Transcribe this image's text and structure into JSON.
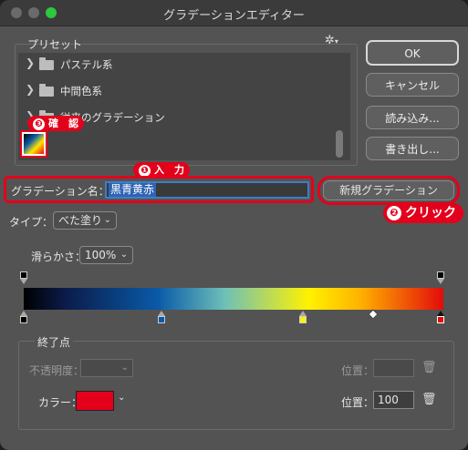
{
  "window": {
    "title": "グラデーションエディター"
  },
  "presets": {
    "label": "プリセット",
    "items": [
      {
        "label": "パステル系"
      },
      {
        "label": "中間色系"
      },
      {
        "label": "従来のグラデーション"
      }
    ]
  },
  "buttons": {
    "ok": "OK",
    "cancel": "キャンセル",
    "load": "読み込み...",
    "save": "書き出し...",
    "new_gradient": "新規グラデーション"
  },
  "annotations": {
    "input_num": "❶",
    "input_text": "入　力",
    "click_num": "❷",
    "click_text": "クリック",
    "confirm_num": "❸",
    "confirm_text": "確　認"
  },
  "name": {
    "label": "グラデーション名：",
    "value": "黒青黄赤"
  },
  "type": {
    "label": "タイプ：",
    "value": "べた塗り"
  },
  "smoothness": {
    "label": "滑らかさ：",
    "value": "100%"
  },
  "gradient": {
    "colors": [
      "#000000",
      "#0a5aa8",
      "#fff200",
      "#e30b0b"
    ],
    "color_stops": [
      "#000000",
      "#0a5aa8",
      "#fff200",
      "#e30b0b"
    ]
  },
  "end_point": {
    "title": "終了点",
    "opacity_label": "不透明度：",
    "opacity_location_label": "位置：",
    "color_label": "カラー：",
    "color_value": "#e3001b",
    "color_location_label": "位置：",
    "color_location_value": "100"
  }
}
